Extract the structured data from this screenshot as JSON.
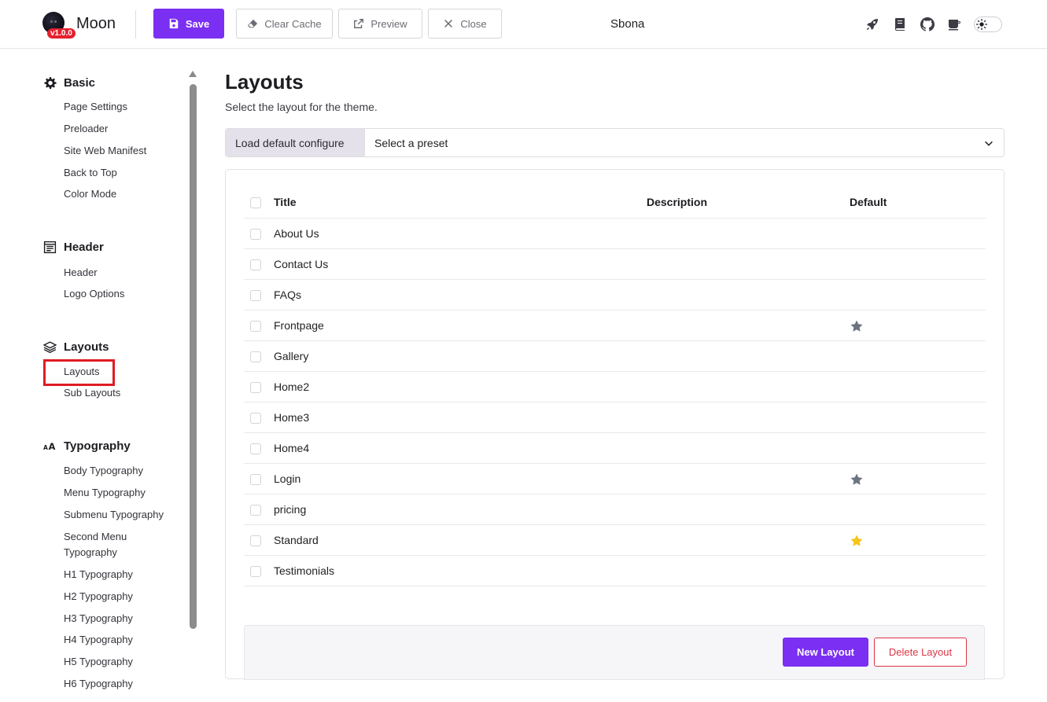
{
  "brand": {
    "name": "Moon",
    "version": "v1.0.0"
  },
  "toolbar": {
    "save_label": "Save",
    "clear_cache_label": "Clear Cache",
    "preview_label": "Preview",
    "close_label": "Close"
  },
  "site_name": "Sbona",
  "header_icons": [
    "rocket-icon",
    "book-icon",
    "github-icon",
    "coffee-icon"
  ],
  "color_mode": "light",
  "sidebar": {
    "groups": [
      {
        "title": "Basic",
        "icon": "gear-icon",
        "items": [
          "Page Settings",
          "Preloader",
          "Site Web Manifest",
          "Back to Top",
          "Color Mode"
        ]
      },
      {
        "title": "Header",
        "icon": "header-icon",
        "items": [
          "Header",
          "Logo Options"
        ]
      },
      {
        "title": "Layouts",
        "icon": "layers-icon",
        "items": [
          "Layouts",
          "Sub Layouts"
        ]
      },
      {
        "title": "Typography",
        "icon": "typography-icon",
        "items": [
          "Body Typography",
          "Menu Typography",
          "Submenu Typography",
          "Second Menu Typography",
          "H1 Typography",
          "H2 Typography",
          "H3 Typography",
          "H4 Typography",
          "H5 Typography",
          "H6 Typography"
        ]
      }
    ],
    "active_item": "Layouts"
  },
  "main": {
    "title": "Layouts",
    "subtitle": "Select the layout for the theme.",
    "preset_label": "Load default configure",
    "preset_value": "Select a preset",
    "columns": {
      "title": "Title",
      "description": "Description",
      "default": "Default"
    },
    "rows": [
      {
        "title": "About Us",
        "description": "",
        "default": ""
      },
      {
        "title": "Contact Us",
        "description": "",
        "default": ""
      },
      {
        "title": "FAQs",
        "description": "",
        "default": ""
      },
      {
        "title": "Frontpage",
        "description": "",
        "default": "gray"
      },
      {
        "title": "Gallery",
        "description": "",
        "default": ""
      },
      {
        "title": "Home2",
        "description": "",
        "default": ""
      },
      {
        "title": "Home3",
        "description": "",
        "default": ""
      },
      {
        "title": "Home4",
        "description": "",
        "default": ""
      },
      {
        "title": "Login",
        "description": "",
        "default": "gray"
      },
      {
        "title": "pricing",
        "description": "",
        "default": ""
      },
      {
        "title": "Standard",
        "description": "",
        "default": "gold"
      },
      {
        "title": "Testimonials",
        "description": "",
        "default": ""
      }
    ],
    "new_button": "New Layout",
    "delete_button": "Delete Layout"
  },
  "colors": {
    "accent": "#7b2ff2",
    "danger": "#dc3545",
    "star_gray": "#6c7480",
    "star_gold": "#f5c518",
    "highlight": "#e01b24"
  }
}
